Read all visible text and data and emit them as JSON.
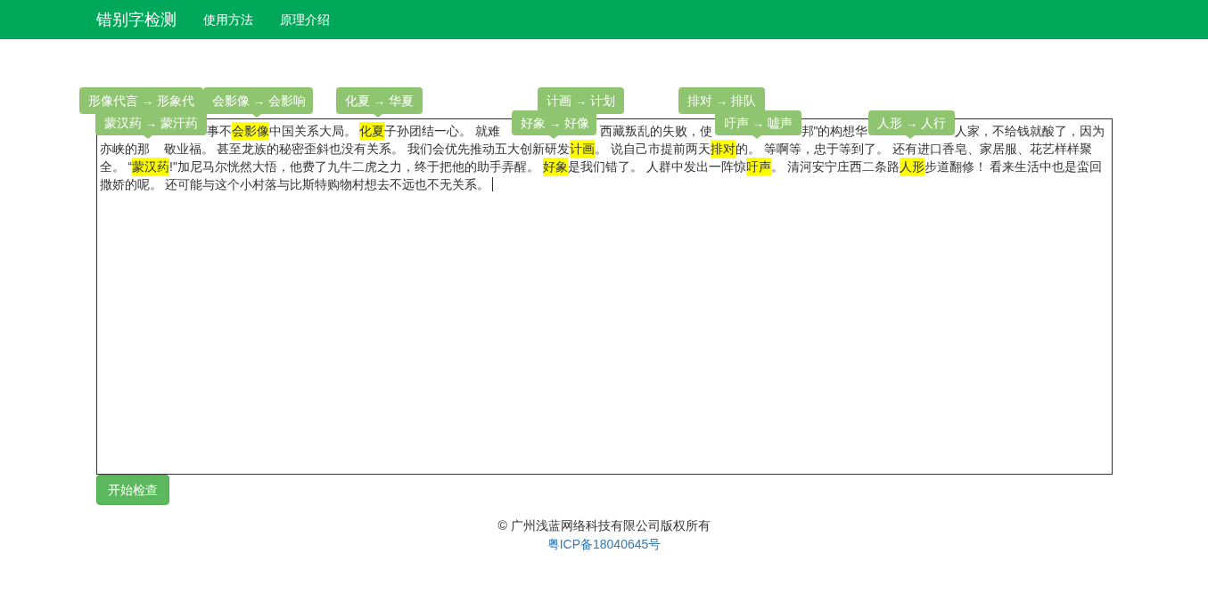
{
  "navbar": {
    "brand": "错别字检测",
    "links": [
      {
        "label": "使用方法"
      },
      {
        "label": "原理介绍"
      }
    ]
  },
  "editor": {
    "lines": [
      [
        {
          "text": "事不",
          "error": false
        },
        {
          "text": "会影像",
          "error": true
        },
        {
          "text": "中国关系大局。 ",
          "error": false
        },
        {
          "text": "化夏",
          "error": true
        },
        {
          "text": "子孙团结一心。 就难",
          "error": false
        },
        {
          "text": "西藏叛乱的失败，使",
          "error": false
        },
        {
          "text": "邦\"的构想华",
          "error": false
        },
        {
          "text": "人家，不给钱就酸了，因为",
          "error": false
        }
      ],
      [
        {
          "text": "亦峡的那",
          "error": false
        },
        {
          "text": "敬业福。 甚至龙族的秘密歪斜也没有关系。 我们会优先推动五大创新研发",
          "error": false
        },
        {
          "text": "计画",
          "error": true
        },
        {
          "text": "。 说自己市提前两天",
          "error": false
        },
        {
          "text": "排对",
          "error": true
        },
        {
          "text": "的。 等啊等，忠于等到了。 还有进口香皂、家居服、花艺样样聚",
          "error": false
        }
      ],
      [
        {
          "text": "全。 “",
          "error": false
        },
        {
          "text": "蒙汉药",
          "error": true
        },
        {
          "text": "!\"加尼马尔恍然大悟，他费了九牛二虎之力，终于把他的助手弄醒。 ",
          "error": false
        },
        {
          "text": "好象",
          "error": true
        },
        {
          "text": "是我们错了。 人群中发出一阵惊",
          "error": false
        },
        {
          "text": "吁声",
          "error": true
        },
        {
          "text": "。 清河安宁庄西二条路",
          "error": false
        },
        {
          "text": "人形",
          "error": true
        },
        {
          "text": "步道翻修！ 看来生活中也是蛮回",
          "error": false
        }
      ],
      [
        {
          "text": "撒娇的呢。 还可能与这个小村落与比斯特购物村想去不远也不无关系。",
          "error": false
        }
      ]
    ]
  },
  "tooltips": [
    {
      "text": "形像代言 → 形象代"
    },
    {
      "text": "会影像 → 会影响"
    },
    {
      "text": "化夏 → 华夏"
    },
    {
      "text": "计画 → 计划"
    },
    {
      "text": "排对 → 排队"
    },
    {
      "text": "蒙汉药 → 蒙汗药"
    },
    {
      "text": "好象 → 好像"
    },
    {
      "text": "吁声 → 嘘声"
    },
    {
      "text": "人形 → 人行"
    }
  ],
  "check_button": "开始检查",
  "footer": {
    "copyright": "© 广州浅蓝网络科技有限公司版权所有",
    "icp": "粤ICP备18040645号"
  }
}
